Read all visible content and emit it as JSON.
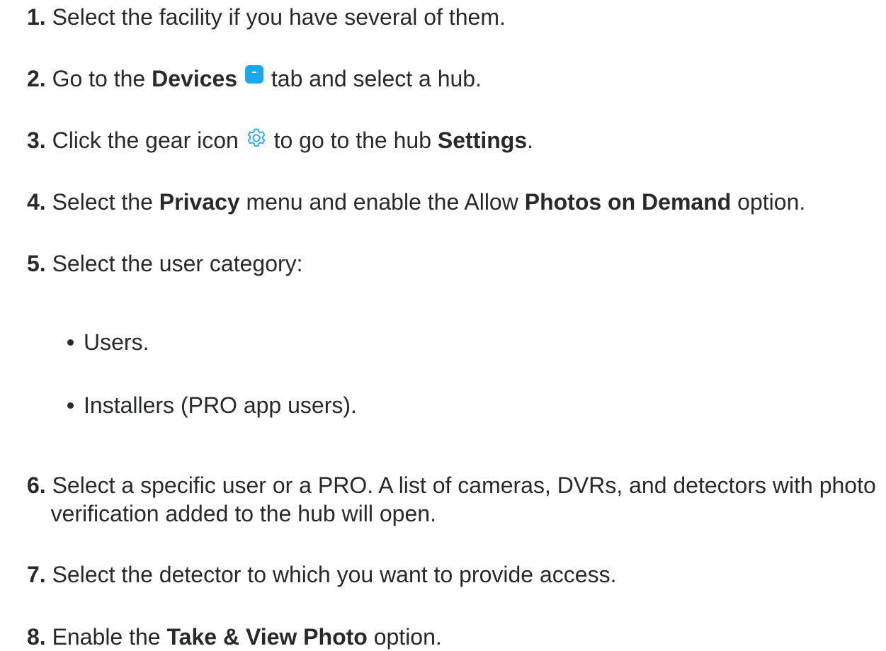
{
  "steps": [
    {
      "num": "1.",
      "text": "Select the facility if you have several of them."
    },
    {
      "num": "2.",
      "pre": "Go to the ",
      "bold": "Devices",
      "post": " tab and select a hub.",
      "icon": "devices-icon"
    },
    {
      "num": "3.",
      "pre": "Click the gear icon ",
      "mid": " to go to the hub ",
      "bold": "Settings",
      "post": ".",
      "icon": "gear-icon"
    },
    {
      "num": "4.",
      "pre": "Select the ",
      "bold1": "Privacy",
      "mid": " menu and enable the Allow ",
      "bold2": "Photos on Demand",
      "post": " option."
    },
    {
      "num": "5.",
      "text": "Select the user category:"
    },
    {
      "num": "6.",
      "text": "Select a specific user or a PRO. A list of cameras, DVRs, and detectors with photo verification added to the hub will open."
    },
    {
      "num": "7.",
      "text": "Select the detector to which you want to provide access."
    },
    {
      "num": "8.",
      "pre": "Enable the ",
      "bold": "Take & View Photo",
      "post": " option."
    }
  ],
  "user_categories": [
    "Users.",
    "Installers (PRO app users)."
  ],
  "colors": {
    "text": "#27292b",
    "accent": "#1aa8ef"
  }
}
